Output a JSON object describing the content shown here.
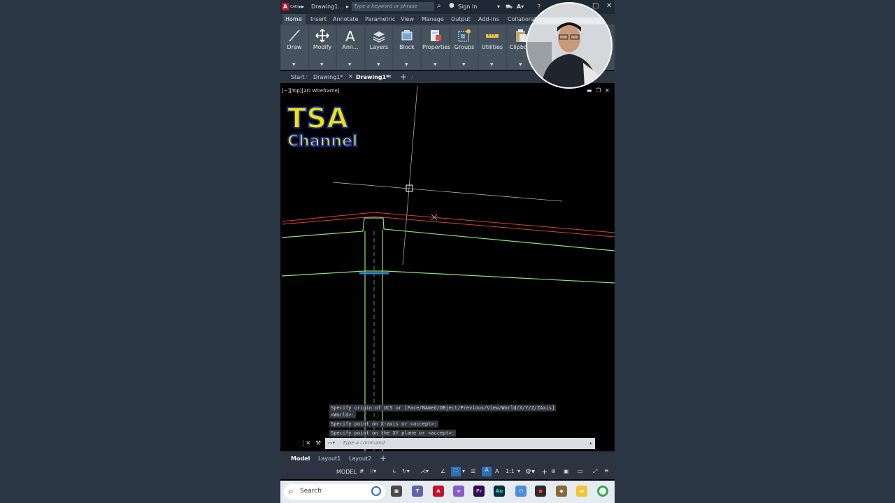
{
  "titlebar": {
    "app_badge": "A",
    "app_badge_sub": "CAD",
    "doc_name": "Drawing1...",
    "search_placeholder": "Type a keyword or phrase",
    "sign_in": "Sign In"
  },
  "ribbon_tabs": [
    "Home",
    "Insert",
    "Annotate",
    "Parametric",
    "View",
    "Manage",
    "Output",
    "Add-ins",
    "Collaborate"
  ],
  "panels": [
    {
      "label": "Draw",
      "icon": "line-icon"
    },
    {
      "label": "Modify",
      "icon": "move-icon"
    },
    {
      "label": "Ann...",
      "icon": "text-icon"
    },
    {
      "label": "Layers",
      "icon": "layers-icon"
    },
    {
      "label": "Block",
      "icon": "block-icon"
    },
    {
      "label": "Properties",
      "icon": "properties-icon"
    },
    {
      "label": "Groups",
      "icon": "groups-icon"
    },
    {
      "label": "Utilities",
      "icon": "measure-icon"
    },
    {
      "label": "Clipbo...",
      "icon": "clipboard-icon"
    }
  ],
  "doc_tabs": {
    "start": "Start",
    "tab1": "Drawing1*",
    "tab2": "Drawing1*"
  },
  "viewport": {
    "label": "[−][Top][2D Wireframe]"
  },
  "watermark": {
    "line1": "TSA",
    "line2": "Channel"
  },
  "command": {
    "history": [
      "Specify origin of UCS or [Face/NAmed/OBject/Previous/View/World/X/Y/Z/ZAxis]",
      "<World>:",
      "Specify point on X-axis or <accept>:",
      "Specify point on the XY plane or <accept>:"
    ],
    "placeholder": "Type a command"
  },
  "layout_tabs": {
    "model": "Model",
    "layout1": "Layout1",
    "layout2": "Layout2"
  },
  "status": {
    "model": "MODEL",
    "scale": "1:1"
  },
  "taskbar": {
    "search": "Search"
  },
  "colors": {
    "accent": "#c8102e",
    "canvas": "#000000",
    "ribbon": "#3f4b59",
    "background": "#2d3847"
  }
}
